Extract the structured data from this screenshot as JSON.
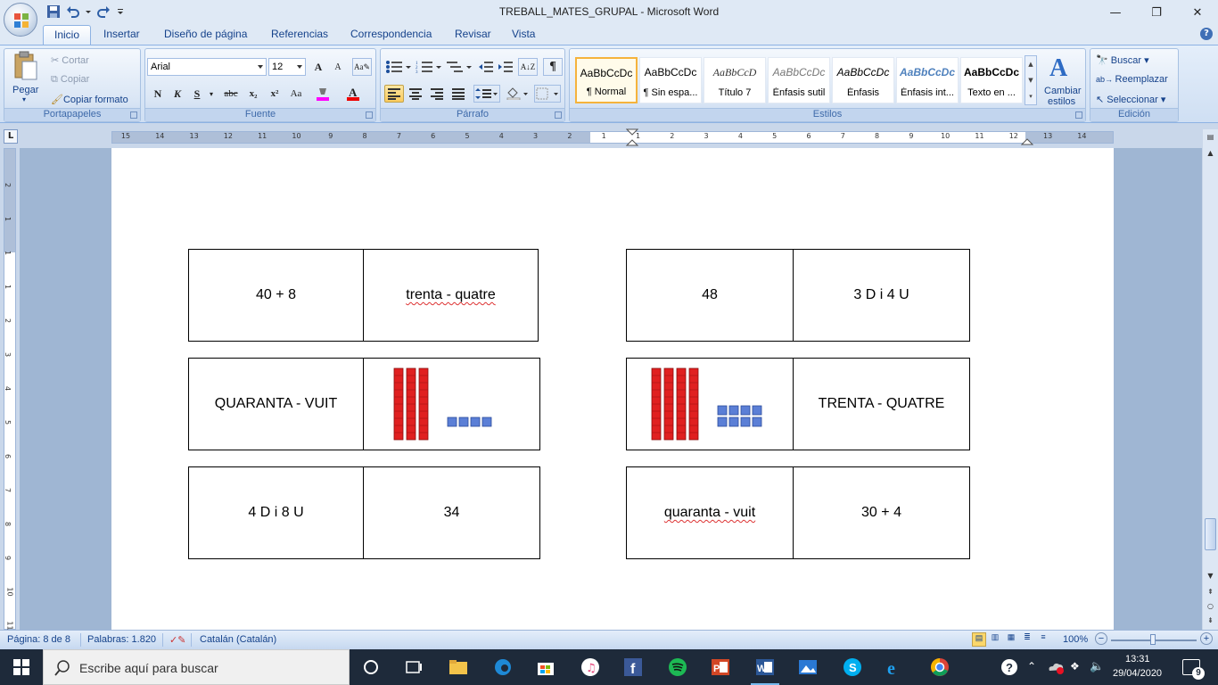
{
  "window": {
    "title": "TREBALL_MATES_GRUPAL - Microsoft Word",
    "minimize": "—",
    "restore": "❐",
    "close": "✕"
  },
  "tabs": [
    "Inicio",
    "Insertar",
    "Diseño de página",
    "Referencias",
    "Correspondencia",
    "Revisar",
    "Vista"
  ],
  "ribbon": {
    "clipboard": {
      "label": "Portapapeles",
      "paste": "Pegar",
      "cut": "Cortar",
      "copy": "Copiar",
      "format_painter": "Copiar formato"
    },
    "font": {
      "label": "Fuente",
      "font_name": "Arial",
      "font_size": "12",
      "bold": "N",
      "italic": "K",
      "underline": "S",
      "strike": "abc",
      "subscript": "x₂",
      "superscript": "x²",
      "change_case": "Aa",
      "grow": "A",
      "shrink": "A"
    },
    "paragraph": {
      "label": "Párrafo"
    },
    "styles": {
      "label": "Estilos",
      "items": [
        {
          "sample": "AaBbCcDc",
          "name": "¶ Normal"
        },
        {
          "sample": "AaBbCcDc",
          "name": "¶ Sin espa..."
        },
        {
          "sample": "AaBbCcD",
          "name": "Título 7"
        },
        {
          "sample": "AaBbCcDc",
          "name": "Énfasis sutil"
        },
        {
          "sample": "AaBbCcDc",
          "name": "Énfasis"
        },
        {
          "sample": "AaBbCcDc",
          "name": "Énfasis int..."
        },
        {
          "sample": "AaBbCcDc",
          "name": "Texto en ..."
        }
      ],
      "change_styles": "Cambiar",
      "change_styles_2": "estilos"
    },
    "editing": {
      "label": "Edición",
      "find": "Buscar",
      "replace": "Reemplazar",
      "select": "Seleccionar"
    }
  },
  "ruler": {
    "labels": [
      "15",
      "14",
      "13",
      "12",
      "11",
      "10",
      "9",
      "8",
      "7",
      "6",
      "5",
      "4",
      "3",
      "2",
      "1",
      "1",
      "2",
      "3",
      "4",
      "5",
      "6",
      "7",
      "8",
      "9",
      "10",
      "11",
      "12",
      "13",
      "14"
    ],
    "vlabels": [
      "2",
      "1",
      "1",
      "1",
      "2",
      "3",
      "4",
      "5",
      "6",
      "7",
      "8",
      "9",
      "10",
      "11"
    ]
  },
  "document": {
    "left_table": [
      [
        "40 + 8",
        "trenta - quatre"
      ],
      [
        "QUARANTA - VUIT",
        ""
      ],
      [
        "4 D i 8 U",
        "34"
      ]
    ],
    "right_table": [
      [
        "48",
        "3 D i 4 U"
      ],
      [
        "",
        "TRENTA - QUATRE"
      ],
      [
        "quaranta - vuit",
        "30 + 4"
      ]
    ]
  },
  "status": {
    "page": "Página: 8 de 8",
    "words": "Palabras: 1.820",
    "language": "Catalán (Catalán)",
    "zoom": "100%"
  },
  "taskbar": {
    "search_placeholder": "Escribe aquí para buscar",
    "time": "13:31",
    "date": "29/04/2020",
    "notifications": "9"
  },
  "colors": {
    "ribbon_blue": "#15428b",
    "base_ten_rod": "#e02020",
    "unit_cube": "#5b7fd6"
  }
}
